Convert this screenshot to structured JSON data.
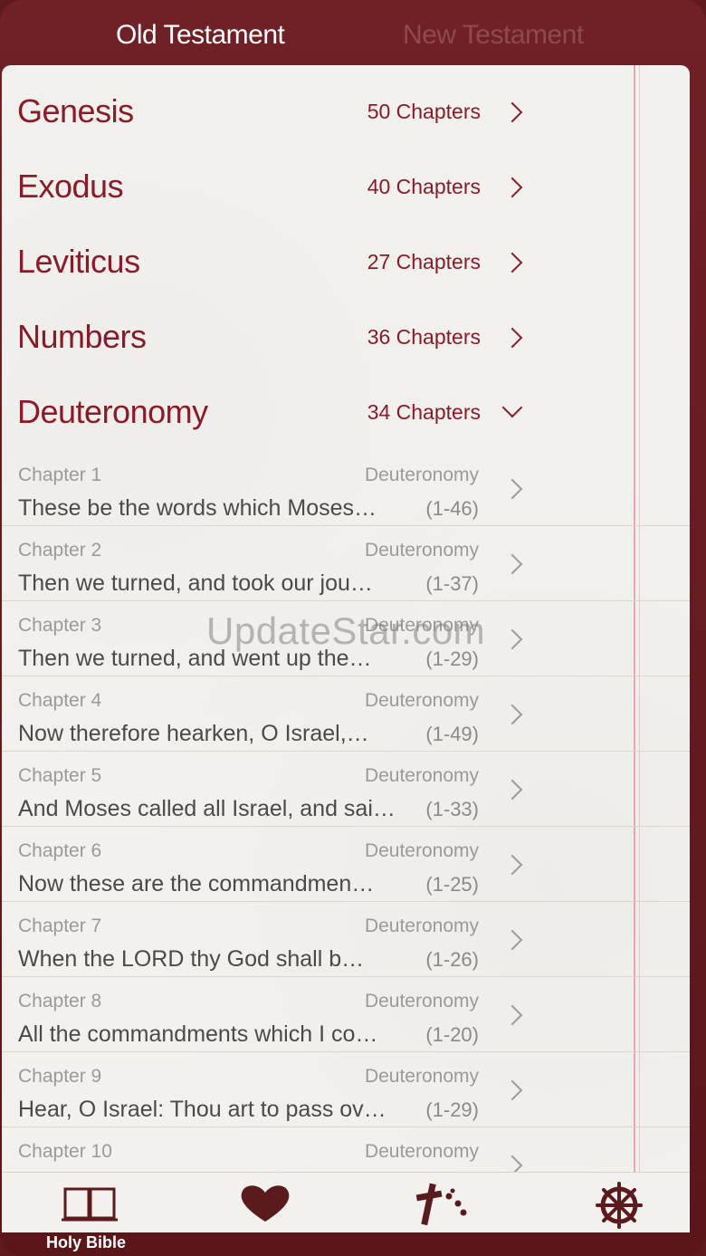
{
  "tabs": {
    "old": "Old Testament",
    "new": "New Testament"
  },
  "books": [
    {
      "name": "Genesis",
      "chapters": "50 Chapters"
    },
    {
      "name": "Exodus",
      "chapters": "40 Chapters"
    },
    {
      "name": "Leviticus",
      "chapters": "27 Chapters"
    },
    {
      "name": "Numbers",
      "chapters": "36 Chapters"
    },
    {
      "name": "Deuteronomy",
      "chapters": "34 Chapters"
    }
  ],
  "chapters": [
    {
      "num": "Chapter 1",
      "book": "Deuteronomy",
      "text": "These be the words which Moses…",
      "range": "(1-46)"
    },
    {
      "num": "Chapter 2",
      "book": "Deuteronomy",
      "text": "Then we turned, and took our jou…",
      "range": "(1-37)"
    },
    {
      "num": "Chapter 3",
      "book": "Deuteronomy",
      "text": "Then we turned, and went up the…",
      "range": "(1-29)"
    },
    {
      "num": "Chapter 4",
      "book": "Deuteronomy",
      "text": "Now therefore hearken, O Israel,…",
      "range": "(1-49)"
    },
    {
      "num": "Chapter 5",
      "book": "Deuteronomy",
      "text": "And Moses called all Israel, and sai…",
      "range": "(1-33)"
    },
    {
      "num": "Chapter 6",
      "book": "Deuteronomy",
      "text": "Now these are the commandmen…",
      "range": "(1-25)"
    },
    {
      "num": "Chapter 7",
      "book": "Deuteronomy",
      "text": "When the LORD thy God shall b…",
      "range": "(1-26)"
    },
    {
      "num": "Chapter 8",
      "book": "Deuteronomy",
      "text": "All the commandments which I co…",
      "range": "(1-20)"
    },
    {
      "num": "Chapter 9",
      "book": "Deuteronomy",
      "text": "Hear, O Israel: Thou art to pass ov…",
      "range": "(1-29)"
    },
    {
      "num": "Chapter 10",
      "book": "Deuteronomy",
      "text": "",
      "range": ""
    }
  ],
  "watermark": "UpdateStar.com",
  "tabbar": {
    "items": [
      {
        "icon": "book-icon",
        "label": "Holy Bible"
      },
      {
        "icon": "heart-icon",
        "label": ""
      },
      {
        "icon": "cross-icon",
        "label": ""
      },
      {
        "icon": "ship-wheel-icon",
        "label": ""
      }
    ]
  },
  "colors": {
    "frame": "#5e1a1e",
    "accent": "#8a1c2a",
    "page": "#f3f1ee"
  }
}
